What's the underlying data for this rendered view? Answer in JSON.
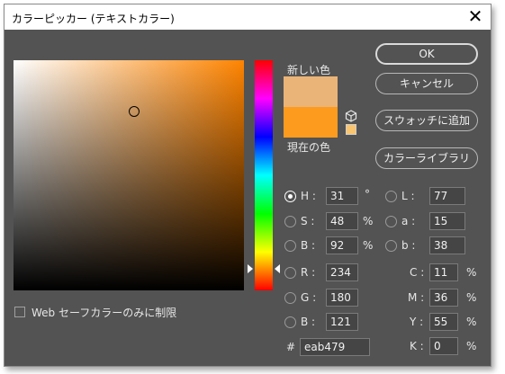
{
  "window": {
    "title": "カラーピッカー (テキストカラー)",
    "close_glyph": "✕"
  },
  "colors": {
    "new_color": "#eab479",
    "current_color": "#fd9b1f",
    "hue_color": "#ff8400",
    "mini_swatch": "#f9c56f"
  },
  "swatch_labels": {
    "new": "新しい色",
    "current": "現在の色"
  },
  "icons": {
    "color_cube": "cube-icon",
    "close": "close-icon"
  },
  "buttons": {
    "ok": "OK",
    "cancel": "キャンセル",
    "add_swatch": "スウォッチに追加",
    "color_library": "カラーライブラリ"
  },
  "hsb": {
    "h": {
      "label": "H :",
      "value": "31",
      "unit": "°",
      "selected": true
    },
    "s": {
      "label": "S :",
      "value": "48",
      "unit": "%",
      "selected": false
    },
    "b": {
      "label": "B :",
      "value": "92",
      "unit": "%",
      "selected": false
    }
  },
  "rgb": {
    "r": {
      "label": "R :",
      "value": "234"
    },
    "g": {
      "label": "G :",
      "value": "180"
    },
    "b": {
      "label": "B :",
      "value": "121"
    }
  },
  "lab": {
    "l": {
      "label": "L :",
      "value": "77"
    },
    "a": {
      "label": "a :",
      "value": "15"
    },
    "b": {
      "label": "b :",
      "value": "38"
    }
  },
  "cmyk": {
    "c": {
      "label": "C :",
      "value": "11",
      "unit": "%"
    },
    "m": {
      "label": "M :",
      "value": "36",
      "unit": "%"
    },
    "y": {
      "label": "Y :",
      "value": "55",
      "unit": "%"
    },
    "k": {
      "label": "K :",
      "value": "0",
      "unit": "%"
    }
  },
  "hex": {
    "label": "#",
    "value": "eab479"
  },
  "web_safe": {
    "label": "Web セーフカラーのみに制限",
    "checked": false
  }
}
